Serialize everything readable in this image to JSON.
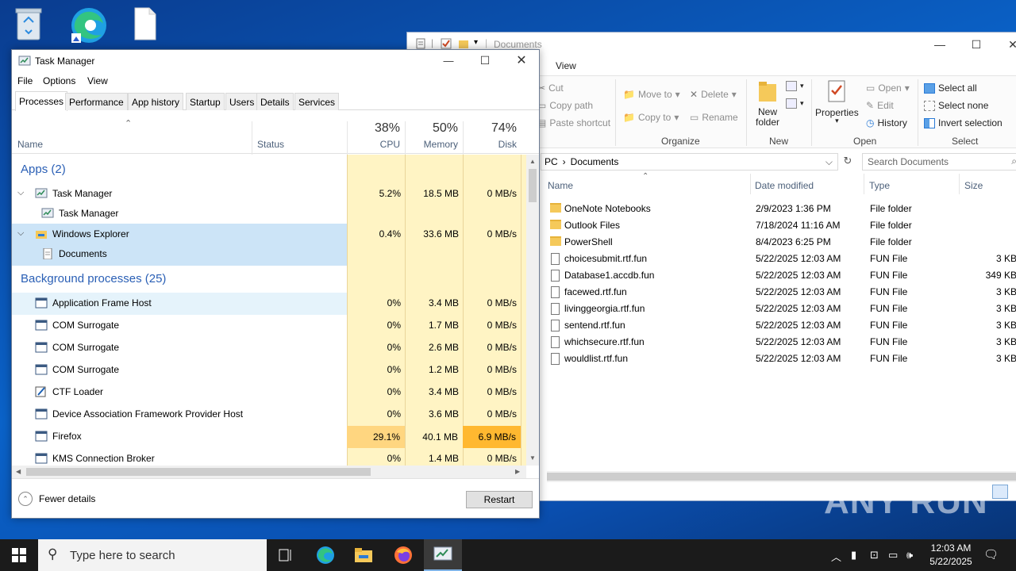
{
  "colors": {
    "accent": "#0078d7",
    "highlight_yellow": "#fff4c4",
    "firefox_cpu": "#ffd680",
    "firefox_disk": "#ffb830",
    "selected_row": "#cce4f7"
  },
  "desktop": {
    "icons": [
      "recycle-bin-icon",
      "edge-icon",
      "file-icon"
    ],
    "watermark": "ANY RUN"
  },
  "explorer": {
    "title": "Documents",
    "ribbon_tab": "View",
    "clipboard": {
      "cut": "Cut",
      "copy_path": "Copy path",
      "paste_shortcut": "Paste shortcut"
    },
    "organize": {
      "move_to": "Move to",
      "copy_to": "Copy to",
      "delete": "Delete",
      "rename": "Rename",
      "group": "Organize"
    },
    "new": {
      "new_folder": "New folder",
      "group": "New"
    },
    "open": {
      "properties": "Properties",
      "open": "Open",
      "edit": "Edit",
      "history": "History",
      "group": "Open"
    },
    "select": {
      "select_all": "Select all",
      "select_none": "Select none",
      "invert": "Invert selection",
      "group": "Select"
    },
    "address": {
      "pc": "PC",
      "sep": "›",
      "folder": "Documents"
    },
    "search_placeholder": "Search Documents",
    "columns": {
      "name": "Name",
      "date": "Date modified",
      "type": "Type",
      "size": "Size"
    },
    "files": [
      {
        "name": "OneNote Notebooks",
        "date": "2/9/2023 1:36 PM",
        "type": "File folder",
        "size": "",
        "kind": "folder"
      },
      {
        "name": "Outlook Files",
        "date": "7/18/2024 11:16 AM",
        "type": "File folder",
        "size": "",
        "kind": "folder"
      },
      {
        "name": "PowerShell",
        "date": "8/4/2023 6:25 PM",
        "type": "File folder",
        "size": "",
        "kind": "folder"
      },
      {
        "name": "choicesubmit.rtf.fun",
        "date": "5/22/2025 12:03 AM",
        "type": "FUN File",
        "size": "3 KB",
        "kind": "file"
      },
      {
        "name": "Database1.accdb.fun",
        "date": "5/22/2025 12:03 AM",
        "type": "FUN File",
        "size": "349 KB",
        "kind": "file"
      },
      {
        "name": "facewed.rtf.fun",
        "date": "5/22/2025 12:03 AM",
        "type": "FUN File",
        "size": "3 KB",
        "kind": "file"
      },
      {
        "name": "livinggeorgia.rtf.fun",
        "date": "5/22/2025 12:03 AM",
        "type": "FUN File",
        "size": "3 KB",
        "kind": "file"
      },
      {
        "name": "sentend.rtf.fun",
        "date": "5/22/2025 12:03 AM",
        "type": "FUN File",
        "size": "3 KB",
        "kind": "file"
      },
      {
        "name": "whichsecure.rtf.fun",
        "date": "5/22/2025 12:03 AM",
        "type": "FUN File",
        "size": "3 KB",
        "kind": "file"
      },
      {
        "name": "wouldlist.rtf.fun",
        "date": "5/22/2025 12:03 AM",
        "type": "FUN File",
        "size": "3 KB",
        "kind": "file"
      }
    ]
  },
  "task_manager": {
    "title": "Task Manager",
    "menu": [
      "File",
      "Options",
      "View"
    ],
    "tabs": [
      "Processes",
      "Performance",
      "App history",
      "Startup",
      "Users",
      "Details",
      "Services"
    ],
    "active_tab": "Processes",
    "columns": {
      "name": "Name",
      "status": "Status",
      "cpu_pct": "38%",
      "cpu": "CPU",
      "mem_pct": "50%",
      "mem": "Memory",
      "disk_pct": "74%",
      "disk": "Disk"
    },
    "apps_header": "Apps (2)",
    "apps": [
      {
        "name": "Task Manager",
        "cpu": "5.2%",
        "mem": "18.5 MB",
        "disk": "0 MB/s",
        "child": "Task Manager",
        "icon": "task-manager-icon"
      },
      {
        "name": "Windows Explorer",
        "cpu": "0.4%",
        "mem": "33.6 MB",
        "disk": "0 MB/s",
        "child": "Documents",
        "icon": "explorer-folder-icon"
      }
    ],
    "bg_header": "Background processes (25)",
    "background": [
      {
        "name": "Application Frame Host",
        "cpu": "0%",
        "mem": "3.4 MB",
        "disk": "0 MB/s",
        "icon": "window-app-icon"
      },
      {
        "name": "COM Surrogate",
        "cpu": "0%",
        "mem": "1.7 MB",
        "disk": "0 MB/s",
        "icon": "window-app-icon"
      },
      {
        "name": "COM Surrogate",
        "cpu": "0%",
        "mem": "2.6 MB",
        "disk": "0 MB/s",
        "icon": "window-app-icon"
      },
      {
        "name": "COM Surrogate",
        "cpu": "0%",
        "mem": "1.2 MB",
        "disk": "0 MB/s",
        "icon": "window-app-icon"
      },
      {
        "name": "CTF Loader",
        "cpu": "0%",
        "mem": "3.4 MB",
        "disk": "0 MB/s",
        "icon": "ctf-loader-icon"
      },
      {
        "name": "Device Association Framework Provider Host",
        "cpu": "0%",
        "mem": "3.6 MB",
        "disk": "0 MB/s",
        "icon": "window-app-icon"
      },
      {
        "name": "Firefox",
        "cpu": "29.1%",
        "mem": "40.1 MB",
        "disk": "6.9 MB/s",
        "icon": "window-app-icon"
      },
      {
        "name": "KMS Connection Broker",
        "cpu": "0%",
        "mem": "1.4 MB",
        "disk": "0 MB/s",
        "icon": "window-app-icon"
      }
    ],
    "fewer_details": "Fewer details",
    "restart": "Restart"
  },
  "taskbar": {
    "search_placeholder": "Type here to search",
    "apps": [
      "task-view-icon",
      "edge-icon",
      "file-explorer-icon",
      "firefox-icon",
      "task-manager-icon"
    ],
    "time": "12:03 AM",
    "date": "5/22/2025"
  }
}
